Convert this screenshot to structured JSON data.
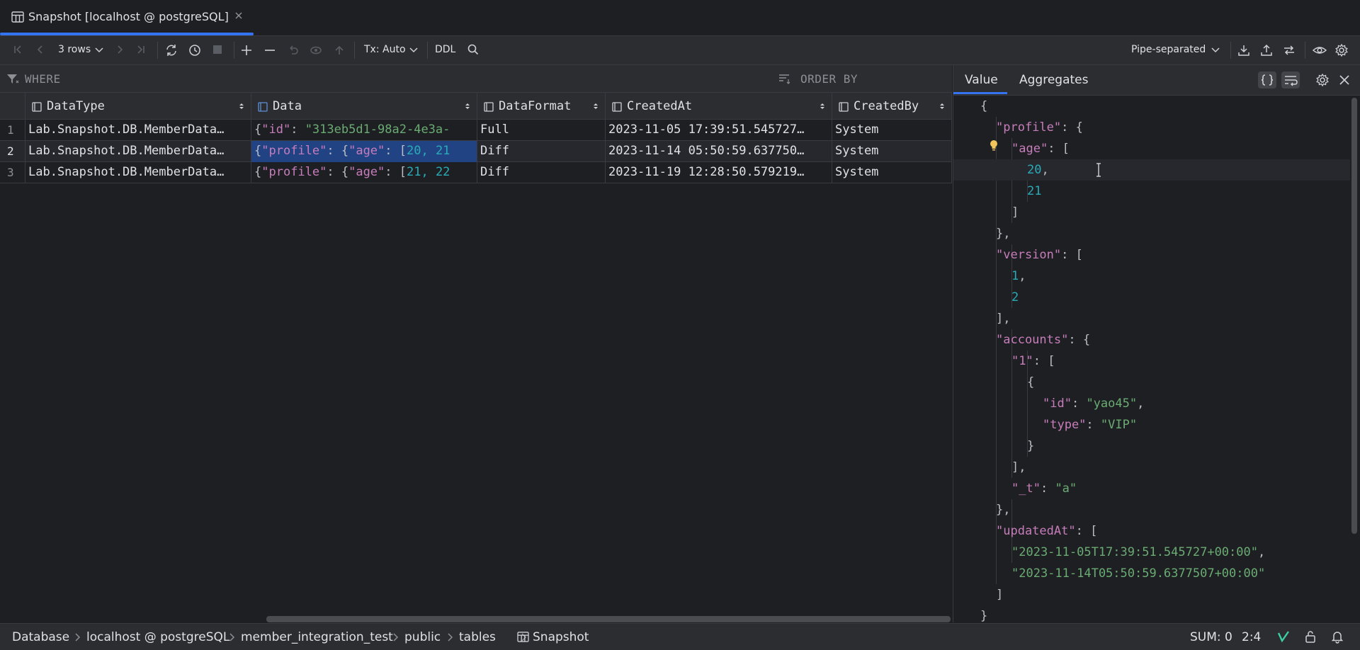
{
  "tab": {
    "title": "Snapshot [localhost @ postgreSQL]"
  },
  "toolbar": {
    "rows_label": "3 rows",
    "tx_label": "Tx: Auto",
    "ddl_label": "DDL",
    "export_format": "Pipe-separated"
  },
  "filter": {
    "where_label": "WHERE",
    "order_label": "ORDER BY"
  },
  "grid": {
    "columns": [
      "DataType",
      "Data",
      "DataFormat",
      "CreatedAt",
      "CreatedBy"
    ],
    "rows": [
      {
        "num": "1",
        "datatype": "Lab.Snapshot.DB.MemberData…",
        "data_parts": [
          "{",
          "\"id\"",
          ": ",
          "\"313eb5d1-98a2-4e3a-",
          "",
          ""
        ],
        "format": "Full",
        "created_at": "2023-11-05 17:39:51.545727…",
        "created_by": "System"
      },
      {
        "num": "2",
        "datatype": "Lab.Snapshot.DB.MemberData…",
        "data_parts": [
          "{",
          "\"profile\"",
          ": {",
          "\"age\"",
          ": [",
          "20, 21"
        ],
        "format": "Diff",
        "created_at": "2023-11-14 05:50:59.637750…",
        "created_by": "System"
      },
      {
        "num": "3",
        "datatype": "Lab.Snapshot.DB.MemberData…",
        "data_parts": [
          "{",
          "\"profile\"",
          ": {",
          "\"age\"",
          ": [",
          "21, 22"
        ],
        "format": "Diff",
        "created_at": "2023-11-19 12:28:50.579219…",
        "created_by": "System"
      }
    ]
  },
  "panel": {
    "tabs": [
      "Value",
      "Aggregates"
    ],
    "json_lines": [
      {
        "indent": 0,
        "tokens": [
          [
            "p",
            "{"
          ]
        ]
      },
      {
        "indent": 1,
        "tokens": [
          [
            "k",
            "\"profile\""
          ],
          [
            "p",
            ": {"
          ]
        ]
      },
      {
        "indent": 2,
        "tokens": [
          [
            "k",
            "\"age\""
          ],
          [
            "p",
            ": ["
          ]
        ]
      },
      {
        "indent": 3,
        "tokens": [
          [
            "n",
            "20"
          ],
          [
            "p",
            ","
          ]
        ]
      },
      {
        "indent": 3,
        "tokens": [
          [
            "n",
            "21"
          ]
        ]
      },
      {
        "indent": 2,
        "tokens": [
          [
            "p",
            "]"
          ]
        ]
      },
      {
        "indent": 1,
        "tokens": [
          [
            "p",
            "},"
          ]
        ]
      },
      {
        "indent": 1,
        "tokens": [
          [
            "k",
            "\"version\""
          ],
          [
            "p",
            ": ["
          ]
        ]
      },
      {
        "indent": 2,
        "tokens": [
          [
            "n",
            "1"
          ],
          [
            "p",
            ","
          ]
        ]
      },
      {
        "indent": 2,
        "tokens": [
          [
            "n",
            "2"
          ]
        ]
      },
      {
        "indent": 1,
        "tokens": [
          [
            "p",
            "],"
          ]
        ]
      },
      {
        "indent": 1,
        "tokens": [
          [
            "k",
            "\"accounts\""
          ],
          [
            "p",
            ": {"
          ]
        ]
      },
      {
        "indent": 2,
        "tokens": [
          [
            "k",
            "\"1\""
          ],
          [
            "p",
            ": ["
          ]
        ]
      },
      {
        "indent": 3,
        "tokens": [
          [
            "p",
            "{"
          ]
        ]
      },
      {
        "indent": 4,
        "tokens": [
          [
            "k",
            "\"id\""
          ],
          [
            "p",
            ": "
          ],
          [
            "s",
            "\"yao45\""
          ],
          [
            "p",
            ","
          ]
        ]
      },
      {
        "indent": 4,
        "tokens": [
          [
            "k",
            "\"type\""
          ],
          [
            "p",
            ": "
          ],
          [
            "s",
            "\"VIP\""
          ]
        ]
      },
      {
        "indent": 3,
        "tokens": [
          [
            "p",
            "}"
          ]
        ]
      },
      {
        "indent": 2,
        "tokens": [
          [
            "p",
            "],"
          ]
        ]
      },
      {
        "indent": 2,
        "tokens": [
          [
            "k",
            "\"_t\""
          ],
          [
            "p",
            ": "
          ],
          [
            "s",
            "\"a\""
          ]
        ]
      },
      {
        "indent": 1,
        "tokens": [
          [
            "p",
            "},"
          ]
        ]
      },
      {
        "indent": 1,
        "tokens": [
          [
            "k",
            "\"updatedAt\""
          ],
          [
            "p",
            ": ["
          ]
        ]
      },
      {
        "indent": 2,
        "tokens": [
          [
            "s",
            "\"2023-11-05T17:39:51.545727+00:00\""
          ],
          [
            "p",
            ","
          ]
        ]
      },
      {
        "indent": 2,
        "tokens": [
          [
            "s",
            "\"2023-11-14T05:50:59.6377507+00:00\""
          ]
        ]
      },
      {
        "indent": 1,
        "tokens": [
          [
            "p",
            "]"
          ]
        ]
      },
      {
        "indent": 0,
        "tokens": [
          [
            "p",
            "}"
          ]
        ]
      }
    ]
  },
  "breadcrumb": [
    "Database",
    "localhost @ postgreSQL",
    "member_integration_test",
    "public",
    "tables",
    "Snapshot"
  ],
  "status": {
    "sum": "SUM: 0",
    "position": "2:4"
  },
  "colors": {
    "accent": "#3574f0",
    "key": "#c77dbb",
    "string": "#6aab73",
    "number": "#2aacb8",
    "selection": "#214283"
  }
}
